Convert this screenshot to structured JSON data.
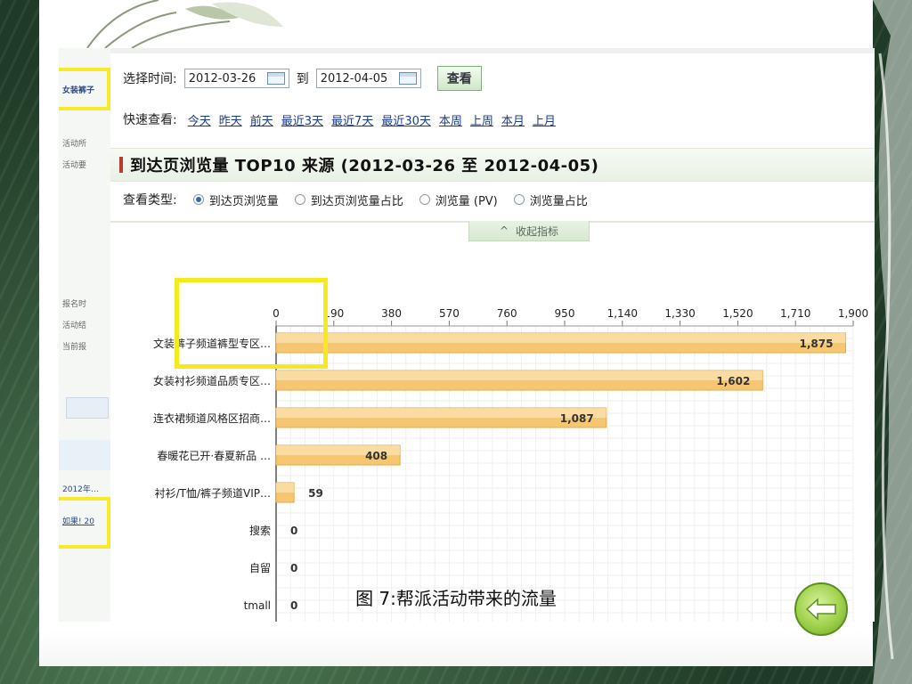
{
  "filter": {
    "label": "选择时间:",
    "start_date": "2012-03-26",
    "to_label": "到",
    "end_date": "2012-04-05",
    "view_button": "查看"
  },
  "quick_view": {
    "label": "快速查看:",
    "links": [
      "今天",
      "昨天",
      "前天",
      "最近3天",
      "最近7天",
      "最近30天",
      "本周",
      "上周",
      "本月",
      "上月"
    ]
  },
  "section_title": "到达页浏览量 TOP10 来源 (2012-03-26 至 2012-04-05)",
  "view_type": {
    "label": "查看类型:",
    "options": [
      "到达页浏览量",
      "到达页浏览量占比",
      "浏览量 (PV)",
      "浏览量占比"
    ],
    "selected_index": 0
  },
  "collapse_label": "收起指标",
  "chart_data": {
    "type": "bar",
    "orientation": "horizontal",
    "categories": [
      "文装裤子频道裤型专区…",
      "女装衬衫频道品质专区…",
      "连衣裙频道风格区招商…",
      "春暖花已开·春夏新品 …",
      "衬衫/T恤/裤子频道VIP…",
      "搜索",
      "自留",
      "tmall"
    ],
    "values": [
      1875,
      1602,
      1087,
      408,
      59,
      0,
      0,
      0
    ],
    "value_labels": [
      "1,875",
      "1,602",
      "1,087",
      "408",
      "59",
      "0",
      "0",
      "0"
    ],
    "x_ticks": [
      "0",
      "190",
      "380",
      "570",
      "760",
      "950",
      "1,140",
      "1,330",
      "1,520",
      "1,710",
      "1,900"
    ],
    "xlim": [
      0,
      1900
    ],
    "grid": true,
    "bar_color": "#f6c770"
  },
  "behind_window": {
    "tag_label": "女装裤子",
    "lines": [
      "活动所",
      "活动要",
      "报名时",
      "活动结",
      "当前报"
    ],
    "footer_date": "2012年…",
    "footer_box": "如果! 20"
  },
  "caption": "图 7:帮派活动带来的流量",
  "nav": {
    "next_icon": "arrow-left-icon"
  }
}
